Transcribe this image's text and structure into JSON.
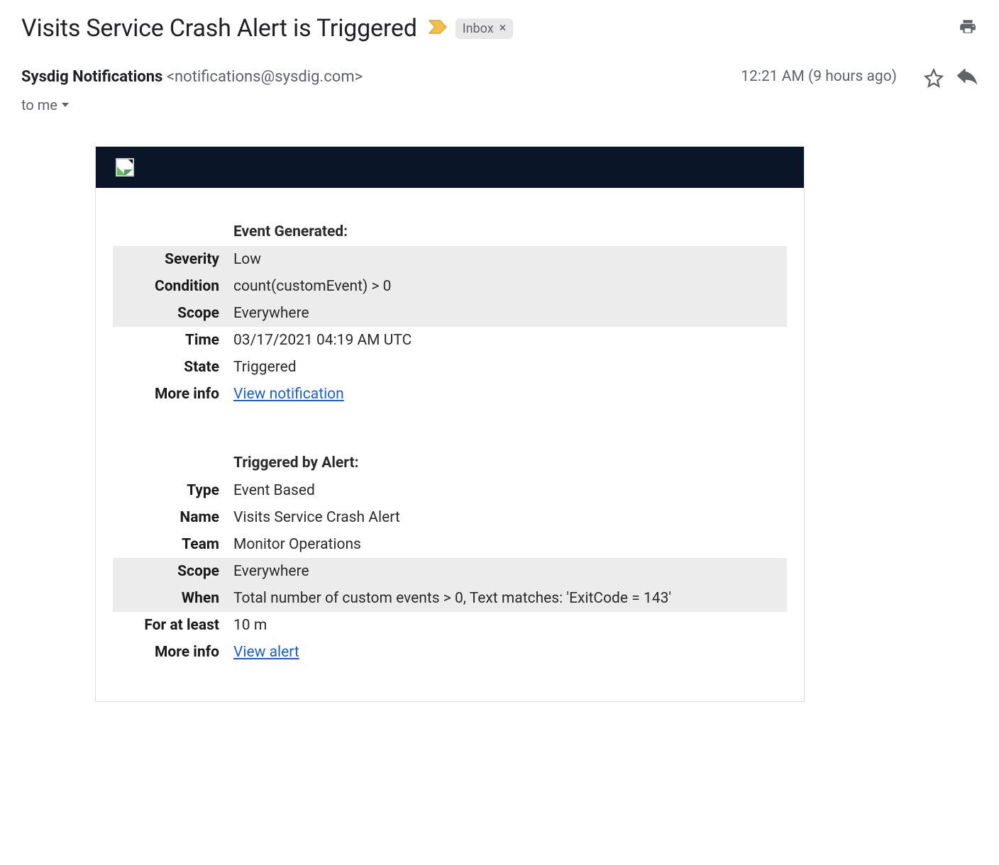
{
  "header": {
    "subject": "Visits Service Crash Alert is Triggered",
    "label": "Inbox",
    "label_close": "×"
  },
  "meta": {
    "sender_name": "Sysdig Notifications",
    "sender_email": "<notifications@sysdig.com>",
    "time": "12:21 AM (9 hours ago)",
    "to": "to me"
  },
  "event": {
    "heading": "Event Generated:",
    "severity_label": "Severity",
    "severity_value": "Low",
    "condition_label": "Condition",
    "condition_value": "count(customEvent) > 0",
    "scope_label": "Scope",
    "scope_value": "Everywhere",
    "time_label": "Time",
    "time_value": "03/17/2021 04:19 AM UTC",
    "state_label": "State",
    "state_value": "Triggered",
    "more_label": "More info",
    "more_link": "View notification"
  },
  "alert": {
    "heading": "Triggered by Alert:",
    "type_label": "Type",
    "type_value": "Event Based",
    "name_label": "Name",
    "name_value": "Visits Service Crash Alert",
    "team_label": "Team",
    "team_value": "Monitor Operations",
    "scope_label": "Scope",
    "scope_value": "Everywhere",
    "when_label": "When",
    "when_value": "Total number of custom events > 0, Text matches: 'ExitCode = 143'",
    "foratleast_label": "For at least",
    "foratleast_value": "10 m",
    "more_label": "More info",
    "more_link": "View alert"
  }
}
